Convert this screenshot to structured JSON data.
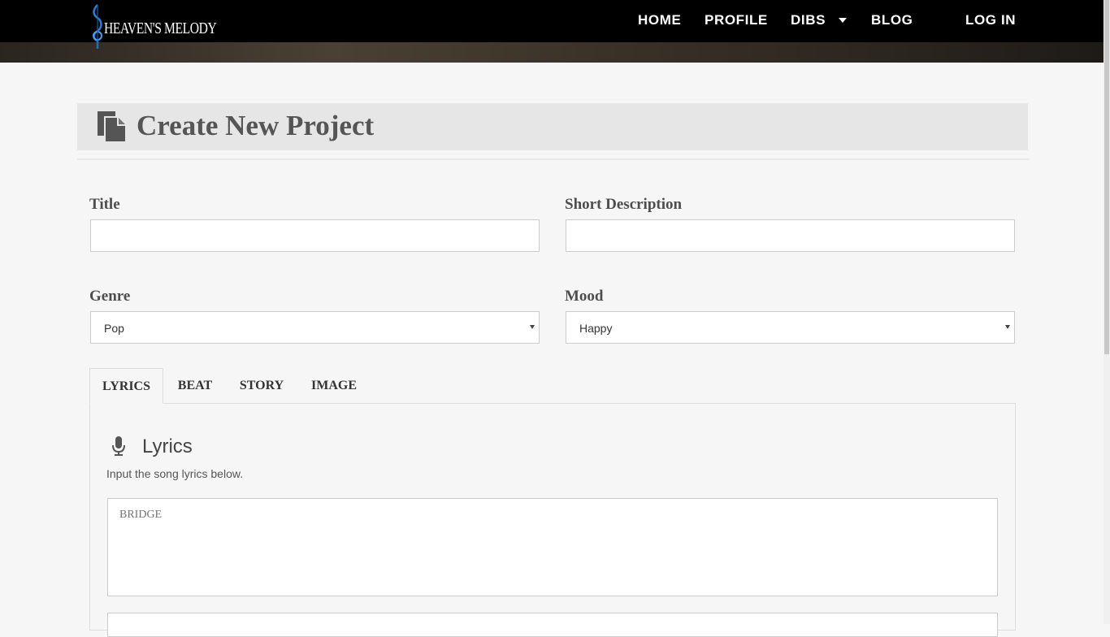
{
  "brand": {
    "logo_text": "HEAVEN'S MELODY"
  },
  "nav": {
    "home": "HOME",
    "profile": "PROFILE",
    "dibs": "DIBS",
    "blog": "BLOG",
    "login": "LOG IN"
  },
  "page": {
    "title": "Create New Project",
    "title_icon": "document-copy-icon"
  },
  "form": {
    "title_label": "Title",
    "title_value": "",
    "short_desc_label": "Short Description",
    "short_desc_value": "",
    "genre_label": "Genre",
    "genre_value": "Pop",
    "mood_label": "Mood",
    "mood_value": "Happy"
  },
  "tabs": [
    {
      "label": "LYRICS",
      "active": true
    },
    {
      "label": "BEAT",
      "active": false
    },
    {
      "label": "STORY",
      "active": false
    },
    {
      "label": "IMAGE",
      "active": false
    }
  ],
  "lyrics": {
    "icon": "microphone-icon",
    "heading": "Lyrics",
    "hint": "Input the song lyrics below.",
    "bridge_placeholder": "BRIDGE"
  },
  "colors": {
    "header_bg": "#000000",
    "title_panel_bg": "#e6e6e6",
    "page_bg": "#f6f6f6"
  }
}
